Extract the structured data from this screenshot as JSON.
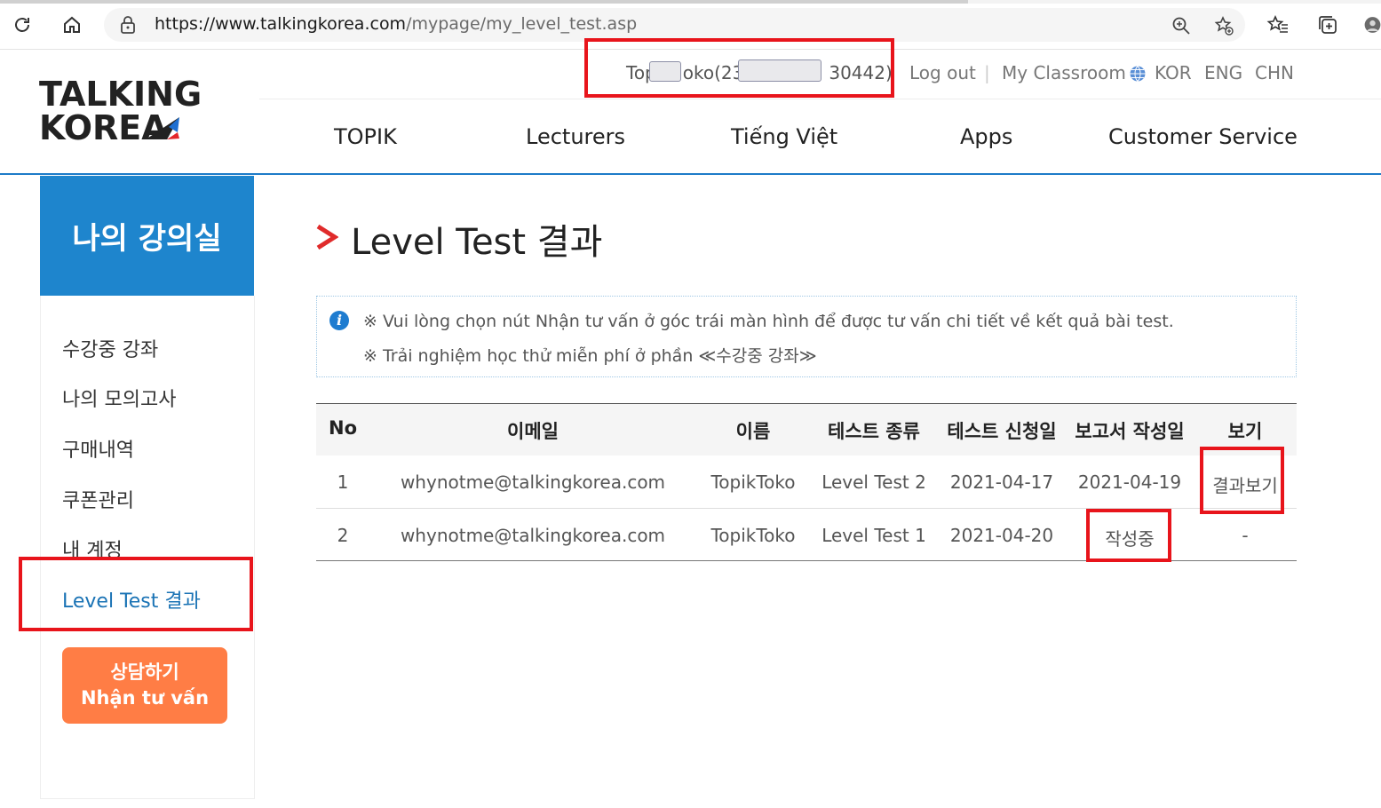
{
  "browser": {
    "url_host": "https://www.talkingkorea.com",
    "url_path": "/mypage/my_level_test.asp"
  },
  "site": {
    "logo_line1": "TALKING",
    "logo_line2": "KOREA",
    "user_prefix": "Top",
    "user_mid": "oko(23",
    "user_suffix": "30442)",
    "logout": "Log out",
    "classroom": "My Classroom",
    "lang": [
      "KOR",
      "ENG",
      "CHN"
    ],
    "nav": [
      "TOPIK",
      "Lecturers",
      "Tiếng Việt",
      "Apps",
      "Customer Service"
    ]
  },
  "sidebar": {
    "title": "나의 강의실",
    "items": [
      "수강중 강좌",
      "나의 모의고사",
      "구매내역",
      "쿠폰관리",
      "내 계정",
      "Level Test 결과"
    ],
    "consult_line1": "상담하기",
    "consult_line2": "Nhận tư vấn"
  },
  "main": {
    "title": "Level Test 결과",
    "notice": [
      "※ Vui lòng chọn nút Nhận tư vấn ở góc trái màn hình để được tư vấn chi tiết về kết quả bài test.",
      "※ Trải nghiệm học thử miễn phí ở phần ≪수강중 강좌≫"
    ],
    "headers": [
      "No",
      "이메일",
      "이름",
      "테스트 종류",
      "테스트 신청일",
      "보고서 작성일",
      "보기"
    ],
    "rows": [
      [
        "1",
        "whynotme@talkingkorea.com",
        "TopikToko",
        "Level Test 2",
        "2021-04-17",
        "2021-04-19",
        "결과보기"
      ],
      [
        "2",
        "whynotme@talkingkorea.com",
        "TopikToko",
        "Level Test 1",
        "2021-04-20",
        "작성중",
        "-"
      ]
    ]
  },
  "colors": {
    "accent_blue": "#1e85cd",
    "consult_orange": "#ff7d45",
    "highlight_red": "#e8141b"
  }
}
